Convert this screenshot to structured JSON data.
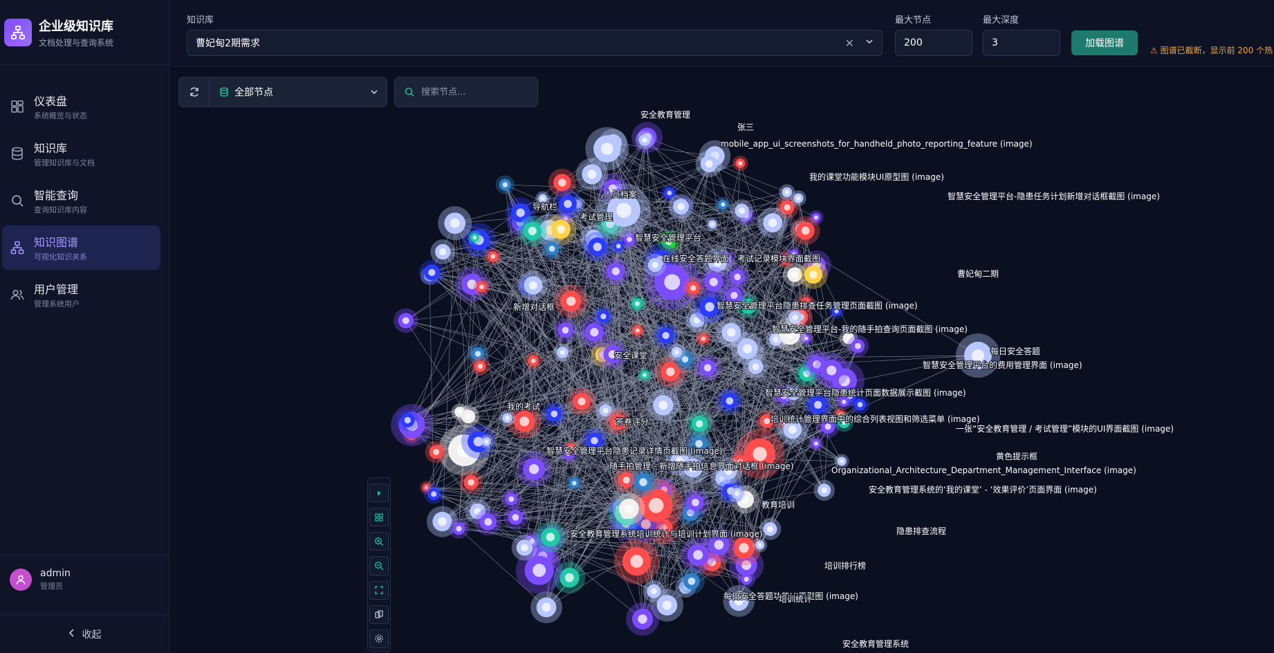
{
  "sidebar": {
    "brand_title": "企业级知识库",
    "brand_subtitle": "文档处理与查询系统",
    "items": [
      {
        "label": "仪表盘",
        "sub": "系统概览与状态",
        "icon": "dashboard-icon"
      },
      {
        "label": "知识库",
        "sub": "管理知识库与文档",
        "icon": "database-icon"
      },
      {
        "label": "智能查询",
        "sub": "查询知识库内容",
        "icon": "search-icon"
      },
      {
        "label": "知识图谱",
        "sub": "可视化知识关系",
        "icon": "graph-icon"
      },
      {
        "label": "用户管理",
        "sub": "管理系统用户",
        "icon": "users-icon"
      }
    ],
    "active_index": 3,
    "user": {
      "name": "admin",
      "role": "管理员"
    },
    "collapse_label": "收起"
  },
  "topbar": {
    "kb_label": "知识库",
    "kb_value": "曹妃甸2期需求",
    "max_nodes_label": "最大节点",
    "max_nodes_value": "200",
    "max_depth_label": "最大深度",
    "max_depth_value": "3",
    "load_button": "加载图谱",
    "warning": "图谱已截断，显示前 200 个热"
  },
  "graph_toolbar": {
    "filter_value": "全部节点",
    "search_placeholder": "搜索节点..."
  },
  "graph": {
    "node_colors": {
      "red": "#ff4d4d",
      "blue": "#2c3cff",
      "violet": "#7b4dff",
      "light": "#b8c8ff",
      "white": "#f0f0f0",
      "teal": "#20c9a5",
      "green": "#1fd83a",
      "yellow": "#ffd24a",
      "steel": "#2f80c8"
    },
    "labels": [
      "安全教育管理",
      "张三",
      "mobile_app_ui_screenshots_for_handheld_photo_reporting_feature (image)",
      "我的课堂功能模块UI原型图 (image)",
      "智慧安全管理平台-隐患任务计划新增对话框截图 (image)",
      "人员档案",
      "导航栏",
      "考试管理",
      "智慧安全管理平台",
      "在线安全答题界面 - 考试记录模块界面截图",
      "曹妃甸二期",
      "新增对话框",
      "智慧安全管理平台隐患排查任务管理页面截图 (image)",
      "智慧安全管理平台-我的随手拍查询页面截图 (image)",
      "安全课堂",
      "每日安全答题",
      "智慧安全管理平台的费用管理界面 (image)",
      "智慧安全管理平台隐患统计页面数据展示截图 (image)",
      "我的考试",
      "答卷评分",
      "培训统计管理界面中的综合列表视图和筛选菜单 (image)",
      "一张“安全教育管理 / 考试管理”模块的UI界面截图 (image)",
      "智慧安全管理平台隐患记录详情页截图 (image)",
      "黄色提示框",
      "随手拍管理 - 新增随手拍信息界面对话框 (image)",
      "Organizational_Architecture_Department_Management_Interface (image)",
      "安全教育管理系统的‘我的课堂’ - ‘效果评价’页面界面 (image)",
      "教育培训",
      "安全教育管理系统培训统计与培训计划界面 (image)",
      "隐患排查流程",
      "培训排行榜",
      "每日安全答题功能UI原型图 (image)",
      "培训统计",
      "安全教育管理系统"
    ]
  }
}
